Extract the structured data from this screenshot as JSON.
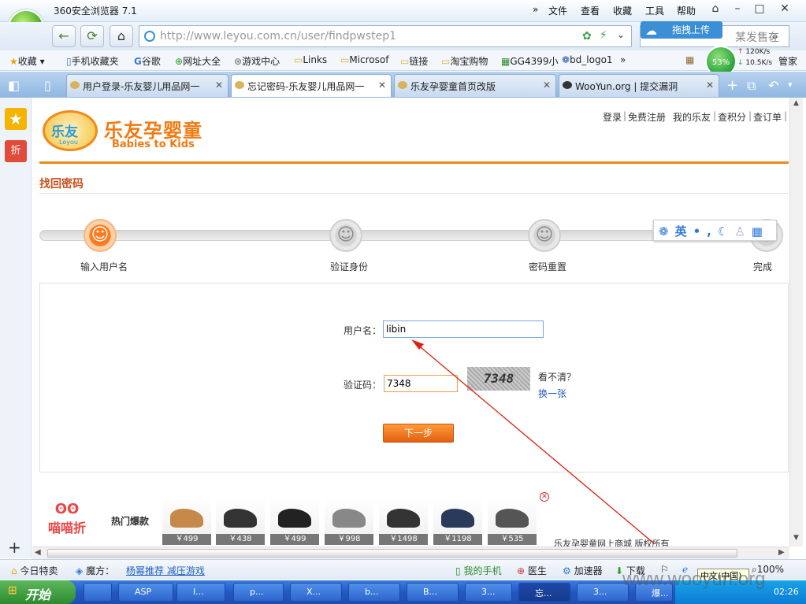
{
  "browser": {
    "title": "360安全浏览器 7.1",
    "menu": [
      "文件",
      "查看",
      "收藏",
      "工具",
      "帮助"
    ],
    "url_host": "http://www.leyou.com.cn/",
    "url_path": "user/findpwstep1",
    "url_domain": "leyou.com.cn",
    "search_placeholder": "某发售在",
    "drag_upload": "拖拽上传",
    "speed_pct": "53%",
    "speed_up": "120K/s",
    "speed_down": "10.5K/s",
    "bookmarks": [
      "收藏",
      "手机收藏夹",
      "谷歌",
      "网址大全",
      "游戏中心",
      "Links",
      "Microsof",
      "链接",
      "淘宝购物",
      "GG4399小",
      "bd_logo1"
    ],
    "bookmarks_more": "»",
    "bookmark_trailing": "管家",
    "tabs": [
      {
        "label": "用户登录-乐友婴儿用品网一"
      },
      {
        "label": "忘记密码-乐友婴儿用品网一"
      },
      {
        "label": "乐友孕婴童首页改版"
      },
      {
        "label": "WooYun.org | 提交漏洞"
      }
    ]
  },
  "site": {
    "logo_cn": "乐友",
    "logo_en": "Leyou",
    "name": "乐友孕婴童",
    "subtitle": "Babies to Kids",
    "top_links": [
      "登录",
      "免费注册",
      "我的乐友",
      "查积分",
      "查订单"
    ],
    "page_title": "找回密码",
    "steps": [
      "输入用户名",
      "验证身份",
      "密码重置",
      "完成"
    ],
    "ime_toolbar": "英",
    "form": {
      "username_label": "用户名：",
      "username_value": "libin",
      "captcha_label": "验证码：",
      "captcha_value": "7348",
      "captcha_image_text": "7348",
      "captcha_unclear": "看不清？",
      "captcha_refresh": "换一张",
      "submit": "下一步"
    },
    "hot": {
      "brand": "喵喵折",
      "title": "热门爆款",
      "prices": [
        "￥499",
        "￥438",
        "￥499",
        "￥998",
        "￥1498",
        "￥1198",
        "￥535"
      ]
    },
    "copyright": "乐友孕婴童网上商城 版权所有"
  },
  "statusbar": {
    "items": [
      "今日特卖",
      "魔方：",
      "杨幂推荐 减压游戏",
      "我的手机",
      "医生",
      "加速器",
      "下载"
    ],
    "zoom": "100%",
    "ime": "中文(中国)"
  },
  "taskbar": {
    "start": "开始",
    "items": [
      "ASP",
      "I...",
      "p...",
      "X...",
      "b...",
      "B...",
      "3...",
      "忘...",
      "3...",
      "爆..."
    ],
    "clock": "02:26"
  },
  "watermark": "www.wooyun.org"
}
